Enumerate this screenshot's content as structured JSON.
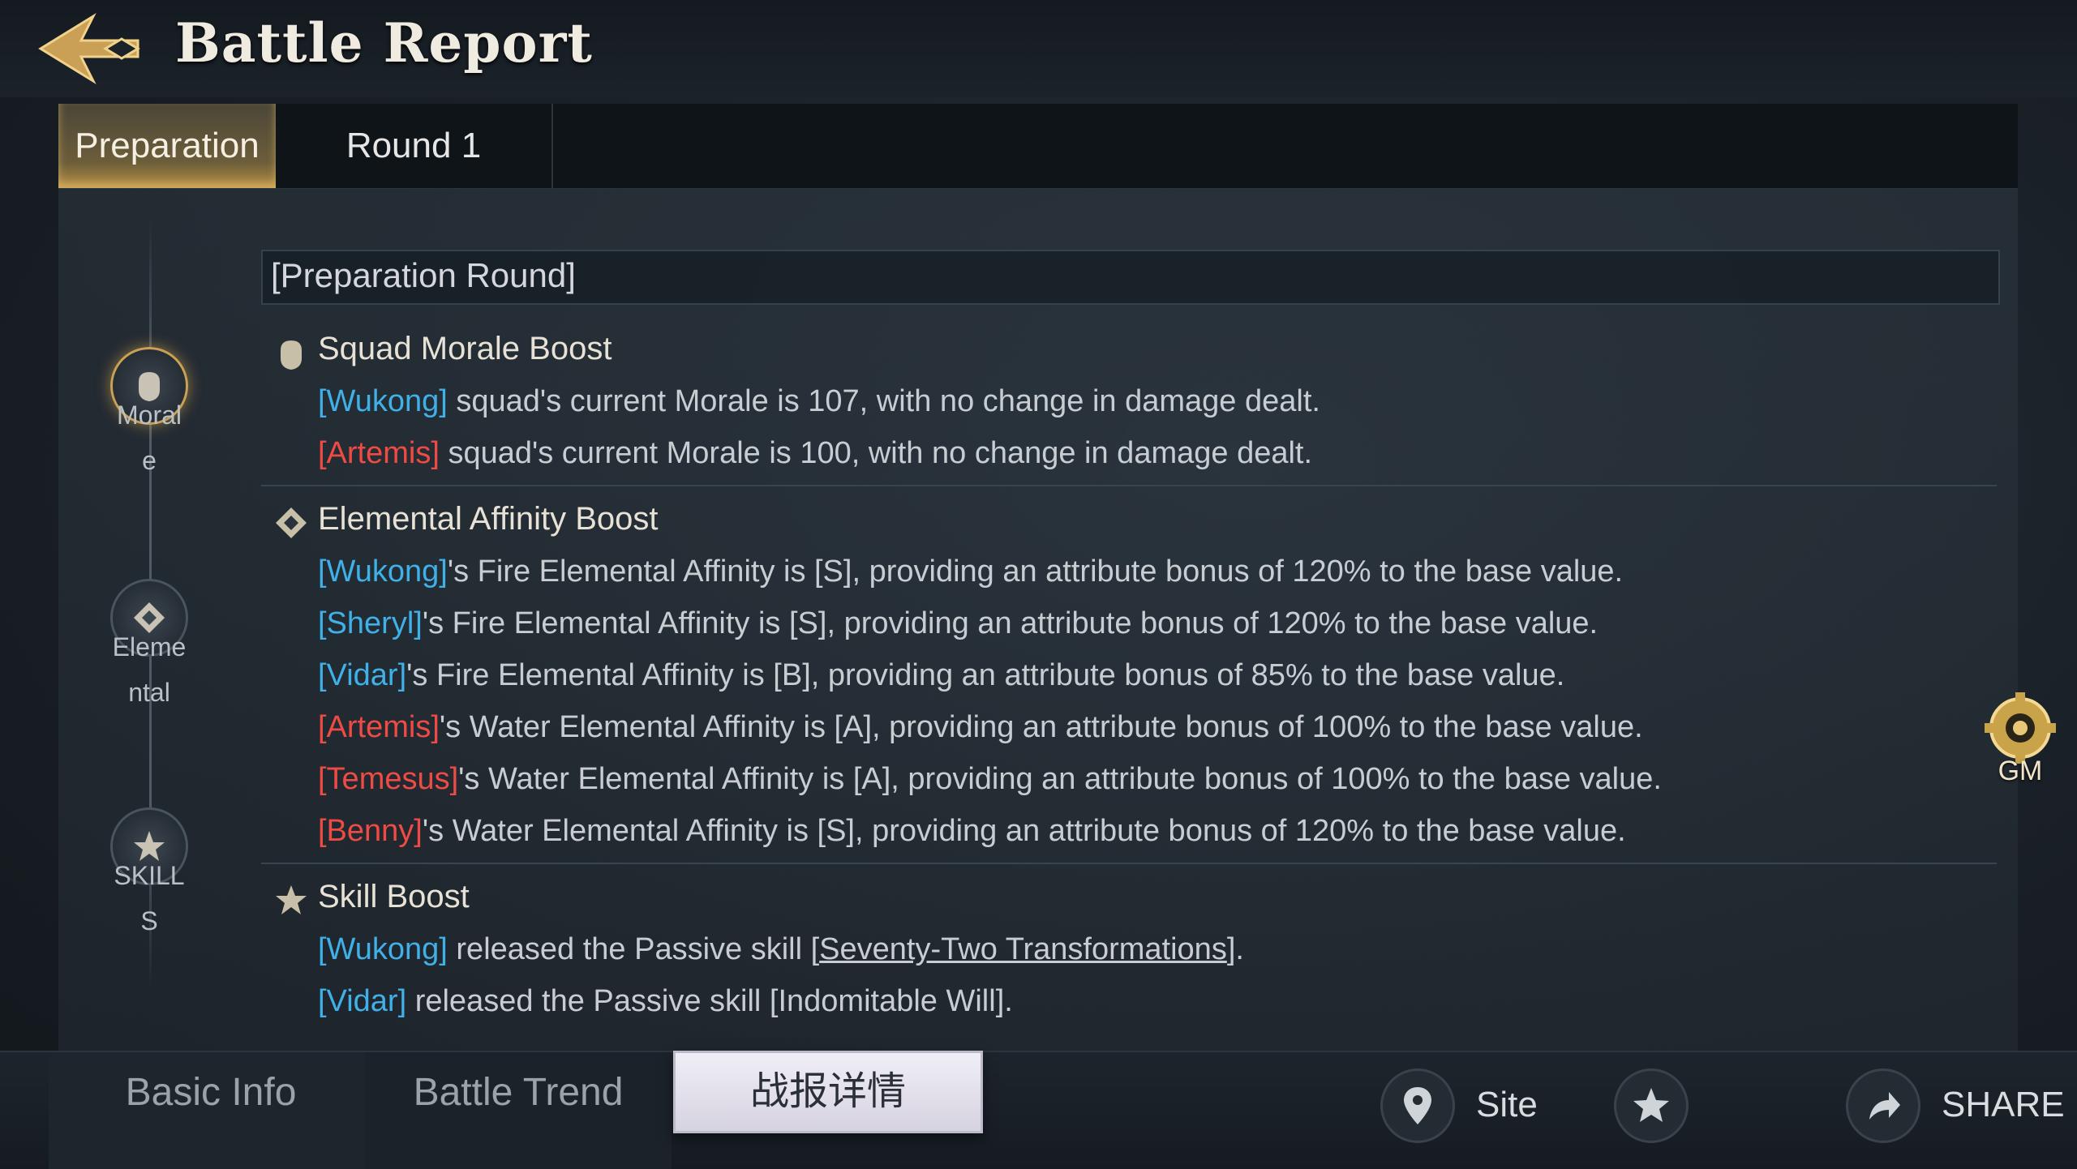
{
  "header": {
    "title": "Battle Report"
  },
  "tabs": [
    {
      "label": "Preparation"
    },
    {
      "label": "Round 1"
    }
  ],
  "timeline": [
    {
      "label": "Morale"
    },
    {
      "label": "Elemental"
    },
    {
      "label": "SKILLS"
    }
  ],
  "section_title": "[Preparation Round]",
  "groups": {
    "morale": {
      "title": "Squad Morale Boost",
      "lines": [
        {
          "name": "[Wukong]",
          "text": " squad's current Morale is 107, with no change in damage dealt."
        },
        {
          "name": "[Artemis]",
          "text": " squad's current Morale is 100, with no change in damage dealt."
        }
      ]
    },
    "elemental": {
      "title": "Elemental Affinity Boost",
      "lines": [
        {
          "name": "[Wukong]",
          "text": "'s Fire Elemental Affinity is [S], providing an attribute bonus of 120% to the base value."
        },
        {
          "name": "[Sheryl]",
          "text": "'s Fire Elemental Affinity is [S], providing an attribute bonus of 120% to the base value."
        },
        {
          "name": "[Vidar]",
          "text": "'s Fire Elemental Affinity is [B], providing an attribute bonus of 85% to the base value."
        },
        {
          "name": "[Artemis]",
          "text": "'s Water Elemental Affinity is [A], providing an attribute bonus of 100% to the base value."
        },
        {
          "name": "[Temesus]",
          "text": "'s Water Elemental Affinity is [A], providing an attribute bonus of 100% to the base value."
        },
        {
          "name": "[Benny]",
          "text": "'s Water Elemental Affinity is [S], providing an attribute bonus of 120% to the base value."
        }
      ]
    },
    "skill": {
      "title": "Skill Boost",
      "lines": [
        {
          "name": "[Wukong]",
          "pre": " released the Passive skill [",
          "skill": "Seventy-Two Transformations",
          "post": "]."
        },
        {
          "name": "[Vidar]",
          "pre": " released the Passive skill [",
          "skill": "Indomitable Will",
          "post": "]."
        }
      ]
    }
  },
  "gm_label": "GM",
  "bottom": {
    "tabs": [
      {
        "label": "Basic Info"
      },
      {
        "label": "Battle Trend"
      },
      {
        "label": "战报详情"
      }
    ],
    "site_label": "Site",
    "share_label": "SHARE"
  },
  "colors": {
    "ally": "#3fb0e8",
    "enemy": "#ef4b45",
    "accent": "#c9a055"
  },
  "icons": [
    "back-arrow-icon",
    "morale-fist-icon",
    "elemental-icon",
    "skills-icon",
    "gear-icon",
    "location-pin-icon",
    "star-icon",
    "share-arrow-icon"
  ]
}
